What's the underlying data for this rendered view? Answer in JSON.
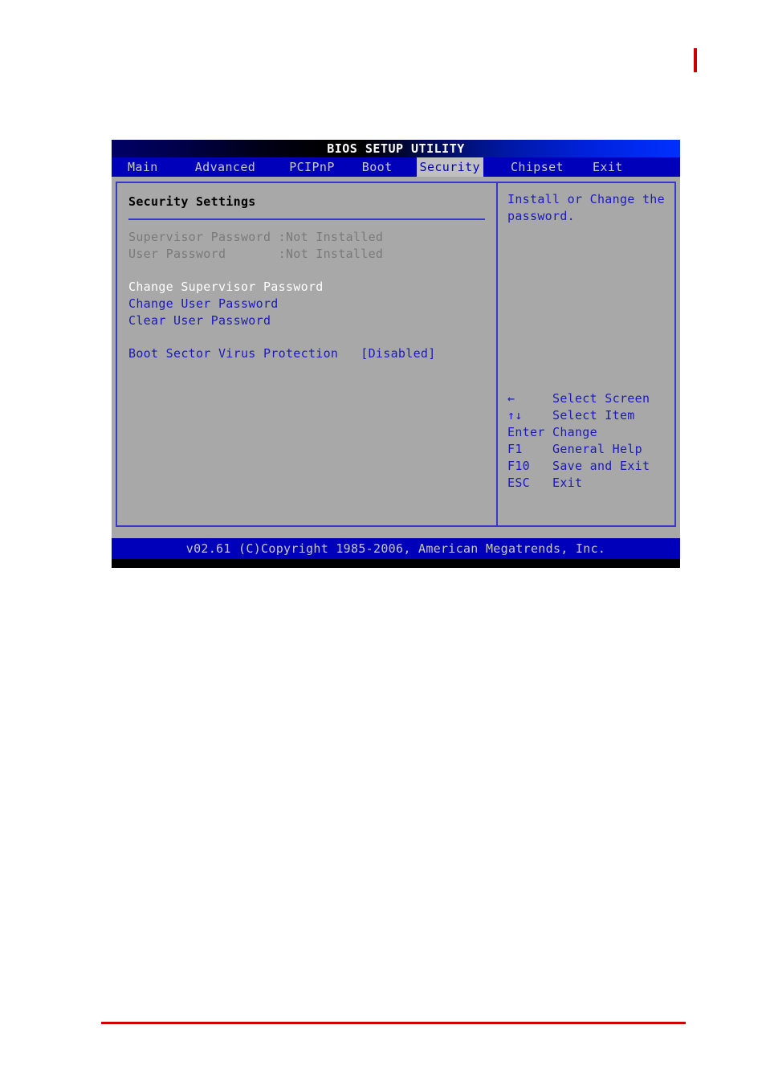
{
  "page": {
    "red_mark": "#cc0000",
    "rule_color": "#cc0000"
  },
  "bios": {
    "title": "BIOS SETUP UTILITY",
    "menu": {
      "items": [
        {
          "label": "Main",
          "active": false
        },
        {
          "label": "Advanced",
          "active": false
        },
        {
          "label": "PCIPnP",
          "active": false
        },
        {
          "label": "Boot",
          "active": false
        },
        {
          "label": "Security",
          "active": true
        },
        {
          "label": "Chipset",
          "active": false
        },
        {
          "label": "Exit",
          "active": false
        }
      ]
    },
    "left_panel": {
      "section_title": "Security Settings",
      "status": [
        {
          "label": "Supervisor Password :Not Installed"
        },
        {
          "label": "User Password       :Not Installed"
        }
      ],
      "actions": [
        {
          "label": "Change Supervisor Password",
          "state": "selected"
        },
        {
          "label": "Change User Password",
          "state": "normal"
        },
        {
          "label": "Clear User Password",
          "state": "normal"
        }
      ],
      "setting": {
        "label": "Boot Sector Virus Protection",
        "value": "[Disabled]",
        "line": "Boot Sector Virus Protection   [Disabled]"
      }
    },
    "right_panel": {
      "help": "Install or Change the\npassword.",
      "legend": [
        {
          "key": "←",
          "action": "Select Screen",
          "line": "←     Select Screen"
        },
        {
          "key": "↑↓",
          "action": "Select Item",
          "line": "↑↓    Select Item"
        },
        {
          "key": "Enter",
          "action": "Change",
          "line": "Enter Change"
        },
        {
          "key": "F1",
          "action": "General Help",
          "line": "F1    General Help"
        },
        {
          "key": "F10",
          "action": "Save and Exit",
          "line": "F10   Save and Exit"
        },
        {
          "key": "ESC",
          "action": "Exit",
          "line": "ESC   Exit"
        }
      ]
    },
    "footer": "v02.61 (C)Copyright 1985-2006, American Megatrends, Inc."
  }
}
